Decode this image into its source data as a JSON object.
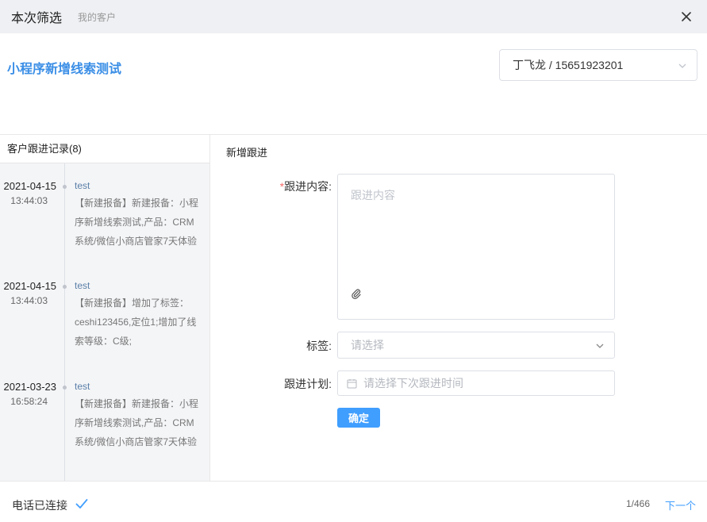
{
  "header": {
    "title": "本次筛选",
    "subtitle": "我的客户"
  },
  "lead": {
    "title": "小程序新增线索测试",
    "contact": "丁飞龙 / 15651923201"
  },
  "records": {
    "title": "客户跟进记录(8)",
    "items": [
      {
        "date": "2021-04-15",
        "time": "13:44:03",
        "user": "test",
        "text": "【新建报备】新建报备：小程序新增线索测试,产品：CRM系统/微信小商店管家7天体验"
      },
      {
        "date": "2021-04-15",
        "time": "13:44:03",
        "user": "test",
        "text": "【新建报备】增加了标签：ceshi123456,定位1;增加了线索等级：C级;"
      },
      {
        "date": "2021-03-23",
        "time": "16:58:24",
        "user": "test",
        "text": "【新建报备】新建报备：小程序新增线索测试,产品：CRM系统/微信小商店管家7天体验"
      }
    ]
  },
  "form": {
    "title": "新增跟进",
    "required_mark": "*",
    "content_label": "跟进内容:",
    "content_placeholder": "跟进内容",
    "tag_label": "标签:",
    "tag_placeholder": "请选择",
    "plan_label": "跟进计划:",
    "plan_placeholder": "请选择下次跟进时间",
    "confirm_label": "确定"
  },
  "footer": {
    "status": "电话已连接",
    "page": "1/466",
    "next_label": "下一个"
  },
  "colors": {
    "accent": "#409eff",
    "title_blue": "#3a8ee6",
    "required": "#f56c6c"
  },
  "icons": {
    "close": "close-icon",
    "dropdown": "chevron-down-icon",
    "attach": "paperclip-icon",
    "calendar": "calendar-icon",
    "connected": "check-icon"
  }
}
